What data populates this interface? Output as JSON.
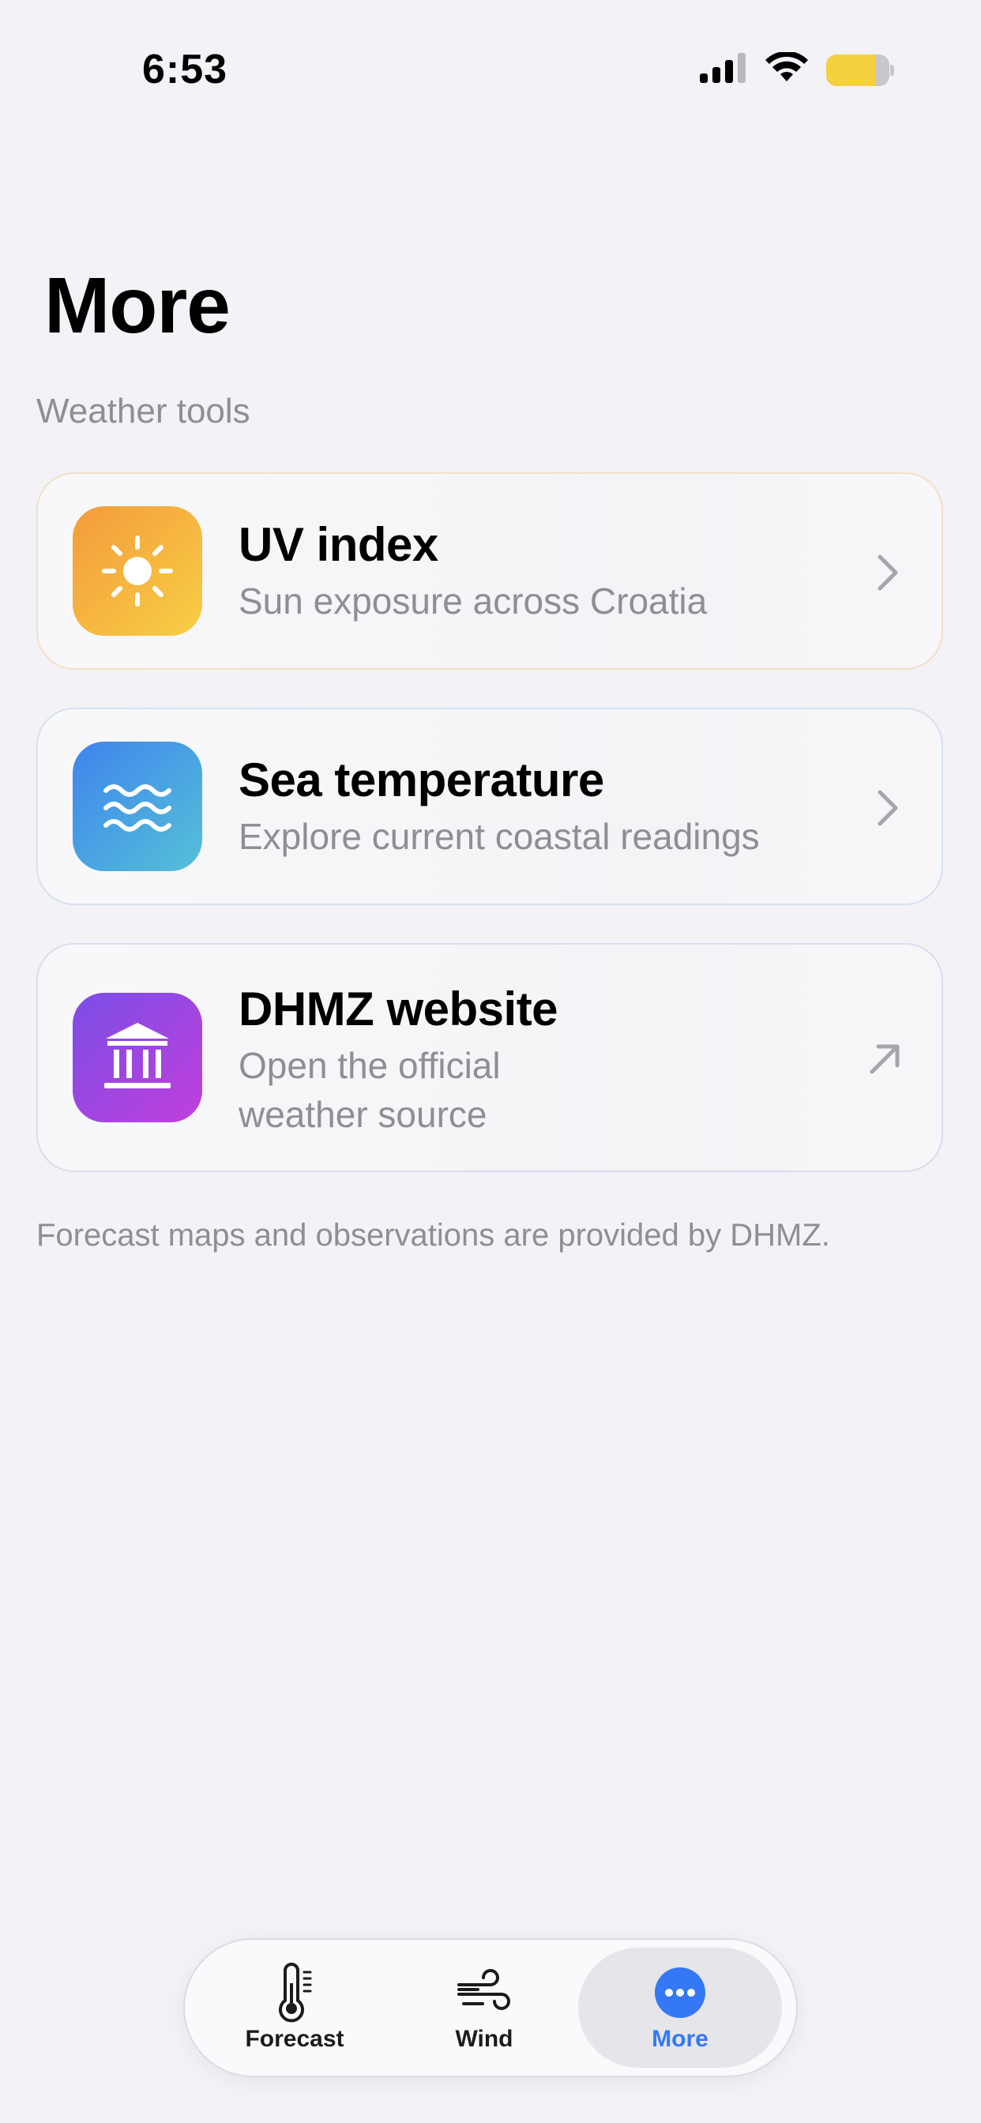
{
  "status_bar": {
    "time": "6:53",
    "battery_level": 0.78,
    "colors": {
      "battery_fill": "#f5d13f"
    }
  },
  "header": {
    "title": "More",
    "section_label": "Weather tools"
  },
  "cards": [
    {
      "title": "UV index",
      "subtitle": "Sun exposure across Croatia",
      "icon": "sun-icon",
      "accessory": "chevron-right-icon",
      "gradient": [
        "#f49b3b",
        "#f7cf45"
      ]
    },
    {
      "title": "Sea temperature",
      "subtitle": "Explore current coastal readings",
      "icon": "waves-icon",
      "accessory": "chevron-right-icon",
      "gradient": [
        "#3f84ee",
        "#55c1d6"
      ]
    },
    {
      "title": "DHMZ website",
      "subtitle": "Open the official weather source",
      "icon": "institution-icon",
      "accessory": "external-arrow-icon",
      "gradient": [
        "#7a4ee6",
        "#c23fdc"
      ]
    }
  ],
  "footnote": "Forecast maps and observations are provided by DHMZ.",
  "tab_bar": {
    "tabs": [
      {
        "label": "Forecast",
        "icon": "thermometer-icon",
        "selected": false
      },
      {
        "label": "Wind",
        "icon": "wind-icon",
        "selected": false
      },
      {
        "label": "More",
        "icon": "ellipsis-circle-icon",
        "selected": true
      }
    ],
    "colors": {
      "selected": "#3478f6"
    }
  }
}
